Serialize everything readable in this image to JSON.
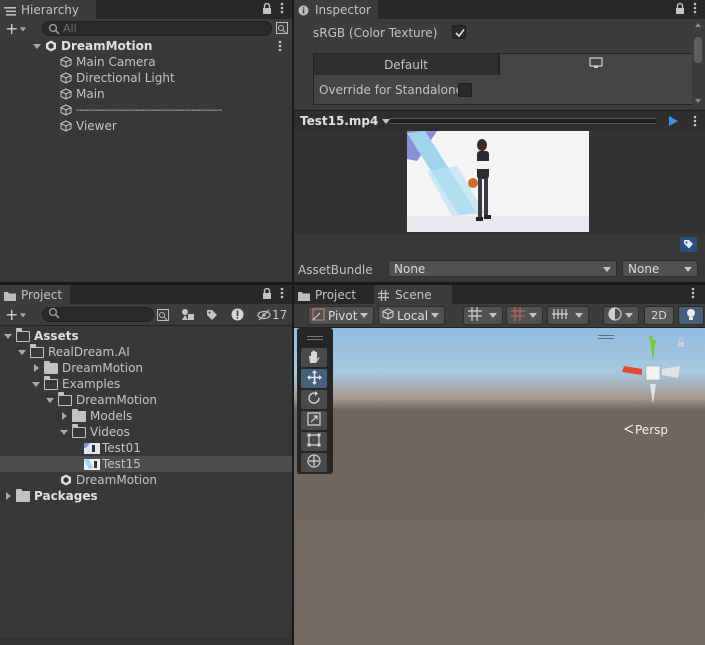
{
  "hierarchy": {
    "tab_label": "Hierarchy",
    "search_placeholder": "All",
    "scene_name": "DreamMotion",
    "items": [
      "Main Camera",
      "Directional Light",
      "Main",
      "-----------------------------------------------",
      "Viewer"
    ]
  },
  "inspector": {
    "tab_label": "Inspector",
    "srgb_label": "sRGB (Color Texture)",
    "srgb_checked": true,
    "platform_default_label": "Default",
    "override_label": "Override for Standalone",
    "preview_asset": "Test15.mp4",
    "assetbundle_label": "AssetBundle",
    "assetbundle_value": "None",
    "assetbundle_variant": "None"
  },
  "project": {
    "tab_label": "Project",
    "hidden_count": "17",
    "tree": {
      "assets": "Assets",
      "realdream": "RealDream.AI",
      "dreammotion_folder": "DreamMotion",
      "examples": "Examples",
      "dreammotion_sub": "DreamMotion",
      "models": "Models",
      "videos": "Videos",
      "test01": "Test01",
      "test15": "Test15",
      "dreammotion_scene": "DreamMotion",
      "packages": "Packages"
    }
  },
  "scene_panel": {
    "project_tab": "Project",
    "scene_tab": "Scene",
    "pivot_label": "Pivot",
    "local_label": "Local",
    "mode_2d": "2D",
    "persp_label": "Persp"
  },
  "colors": {
    "panel_bg": "#383838",
    "tab_bg": "#282828",
    "selection": "#4c4c4c",
    "accent_blue": "#46607c",
    "gizmo_y": "#7ac943",
    "gizmo_x": "#e54a2e"
  }
}
